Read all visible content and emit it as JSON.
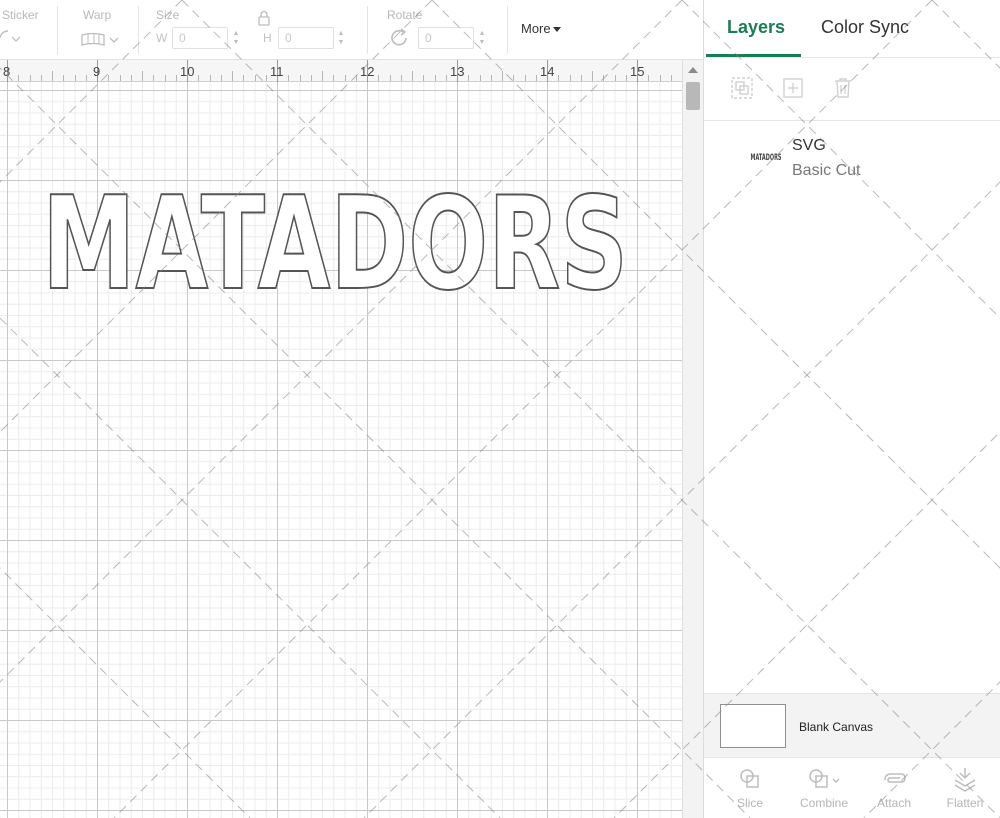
{
  "toolbar": {
    "sticker_label": "Sticker",
    "warp_label": "Warp",
    "size_label": "Size",
    "size_w_letter": "W",
    "size_w_value": "0",
    "size_h_letter": "H",
    "size_h_value": "0",
    "rotate_label": "Rotate",
    "rotate_value": "0",
    "more_label": "More",
    "icons": [
      "sticker-icon",
      "warp-icon",
      "lock-icon",
      "rotate-icon"
    ]
  },
  "ruler": {
    "labels": [
      "8",
      "9",
      "10",
      "11",
      "12",
      "13",
      "14",
      "15"
    ]
  },
  "canvas": {
    "design_text": "MATADORS"
  },
  "panel": {
    "tabs": [
      {
        "label": "Layers",
        "active": true
      },
      {
        "label": "Color Sync",
        "active": false
      }
    ],
    "tool_icons": [
      "group-icon",
      "add-layer-icon",
      "trash-icon"
    ],
    "layer": {
      "name": "SVG",
      "operation": "Basic Cut",
      "thumb_text": "MATADORS"
    },
    "blank_canvas_label": "Blank Canvas",
    "bottom_tools": [
      {
        "label": "Slice",
        "icon": "slice-icon"
      },
      {
        "label": "Combine",
        "icon": "combine-icon"
      },
      {
        "label": "Attach",
        "icon": "attach-icon"
      },
      {
        "label": "Flatten",
        "icon": "flatten-icon"
      }
    ]
  },
  "colors": {
    "accent": "#1e7b57",
    "grid_major": "#c9c9c9",
    "grid_minor": "#ececec",
    "outline": "#555555"
  }
}
